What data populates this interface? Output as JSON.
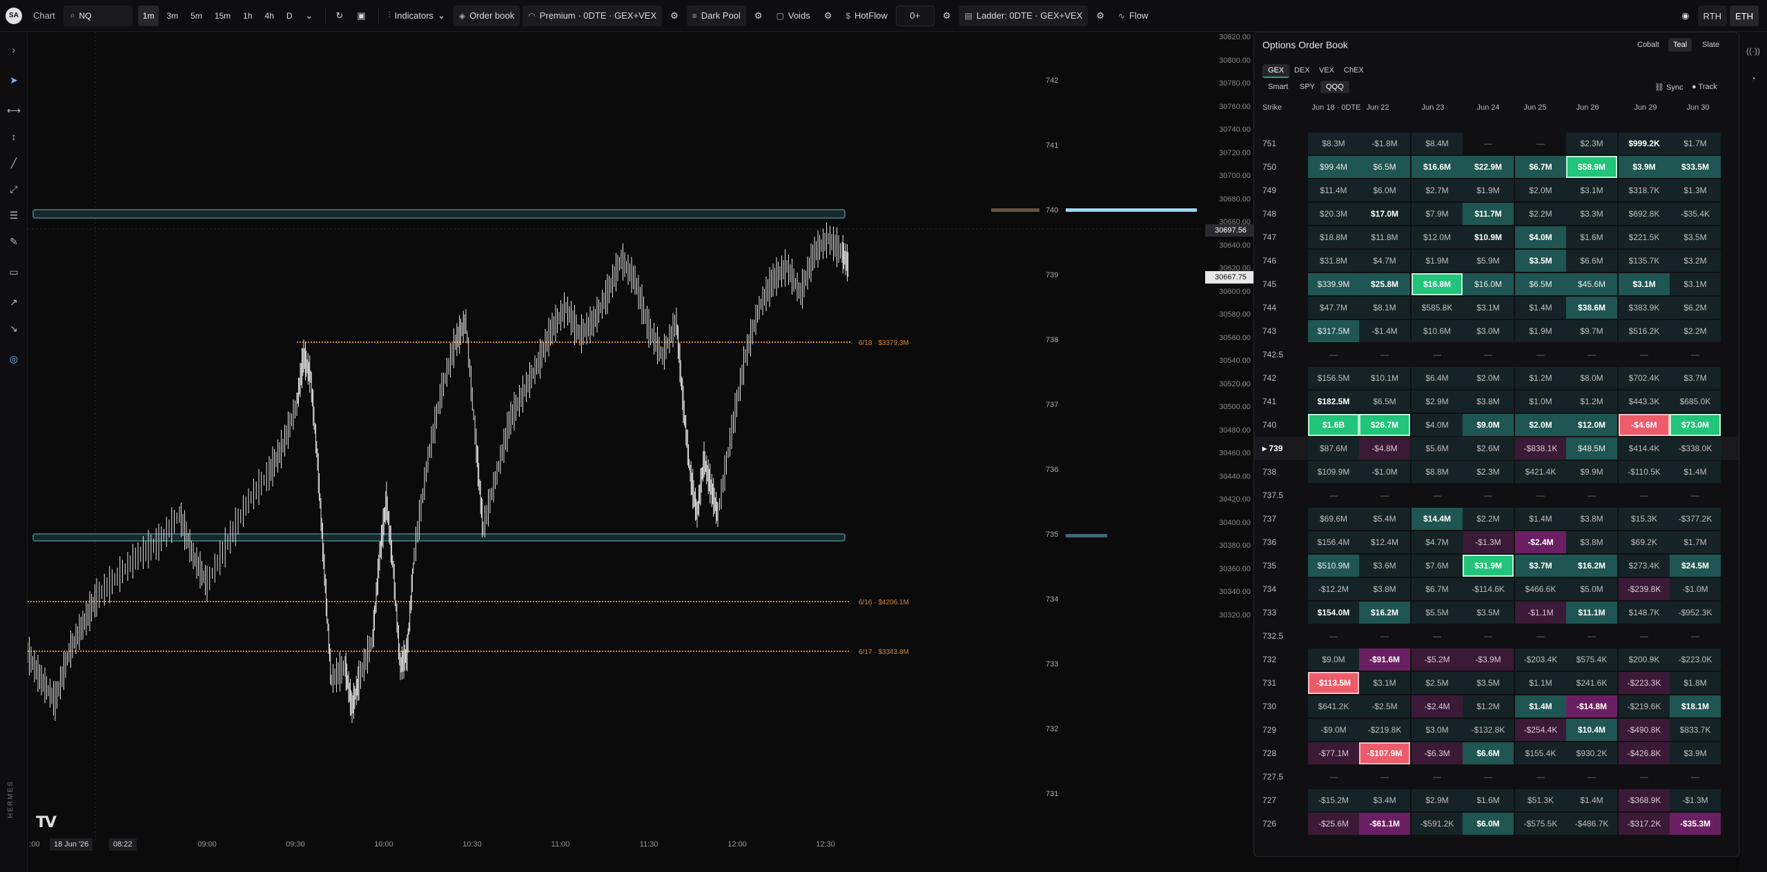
{
  "topbar": {
    "avatar": "SA",
    "app_title": "Chart",
    "symbol": "NQ",
    "timeframes": [
      "1m",
      "3m",
      "5m",
      "15m",
      "1h",
      "4h",
      "D"
    ],
    "selected_timeframe": "1m",
    "indicators": "Indicators",
    "order_book": "Order book",
    "premium": "Premium · 0DTE · GEX+VEX",
    "dark_pool": "Dark Pool",
    "voids": "Voids",
    "hotflow": "HotFlow",
    "hotflow_value": "0+",
    "ladder": "Ladder: 0DTE · GEX+VEX",
    "flow": "Flow",
    "rth": "RTH",
    "eth": "ETH"
  },
  "leftbar": {
    "brand": "HERMES"
  },
  "chart": {
    "price_axis_labels": [
      "30820.00",
      "30800.00",
      "30780.00",
      "30760.00",
      "30740.00",
      "30720.00",
      "30700.00",
      "30680.00",
      "30660.00",
      "30640.00",
      "30620.00",
      "30600.00",
      "30580.00",
      "30560.00",
      "30540.00",
      "30520.00",
      "30500.00",
      "30480.00",
      "30460.00",
      "30440.00",
      "30420.00",
      "30400.00",
      "30380.00",
      "30360.00",
      "30340.00",
      "30320.00"
    ],
    "price_badge_1": "30697.56",
    "price_badge_2": "30667.75",
    "strike_labels": [
      "742",
      "741",
      "740",
      "739",
      "738",
      "737",
      "736",
      "735",
      "734",
      "733",
      "732",
      "731"
    ],
    "time_labels": [
      "09:00",
      "09:30",
      "10:00",
      "10:30",
      "11:00",
      "11:30",
      "12:00",
      "12:30"
    ],
    "cursor_date": "18 Jun '26",
    "cursor_time": "08:22",
    "axis_start": ":00",
    "annotations": [
      "6/18 · $3379.3M",
      "6/16 · $4206.1M",
      "6/17 · $3343.8M"
    ],
    "logo": "TV",
    "colors": {
      "candle": "#e6e6e6",
      "gamma_level": "#3d6b70",
      "dark_pool": "#d4883a",
      "highlight": "#9bd8f0"
    }
  },
  "order_book": {
    "title": "Options Order Book",
    "themes": [
      "Cobalt",
      "Teal",
      "Slate"
    ],
    "selected_theme": "Teal",
    "greeks": [
      "GEX",
      "DEX",
      "VEX",
      "ChEX"
    ],
    "selected_greek": "GEX",
    "symbols": [
      "Smart",
      "SPY",
      "QQQ"
    ],
    "selected_symbol": "QQQ",
    "sync": "Sync",
    "track": "Track",
    "columns": [
      "Strike",
      "Jun 18 · 0DTE",
      "Jun 22",
      "Jun 23",
      "Jun 24",
      "Jun 25",
      "Jun 26",
      "Jun 29",
      "Jun 30"
    ],
    "current_strike": "739",
    "rows": [
      {
        "strike": "751",
        "cells": [
          [
            "$8.3M",
            "n"
          ],
          [
            "-$1.8M",
            "n"
          ],
          [
            "$8.4M",
            "n"
          ],
          [
            "—",
            "e"
          ],
          [
            "—",
            "e"
          ],
          [
            "$2.3M",
            "n"
          ],
          [
            "$999.2K",
            "wb"
          ],
          [
            "$1.7M",
            "n"
          ]
        ]
      },
      {
        "strike": "750",
        "cells": [
          [
            "$99.4M",
            "t"
          ],
          [
            "$6.5M",
            "t"
          ],
          [
            "$16.6M",
            "tb"
          ],
          [
            "$22.9M",
            "tb"
          ],
          [
            "$6.7M",
            "tb"
          ],
          [
            "$58.9M",
            "g"
          ],
          [
            "$3.9M",
            "tb"
          ],
          [
            "$33.5M",
            "tb"
          ]
        ]
      },
      {
        "strike": "749",
        "cells": [
          [
            "$11.4M",
            "n"
          ],
          [
            "$6.0M",
            "n"
          ],
          [
            "$2.7M",
            "n"
          ],
          [
            "$1.9M",
            "n"
          ],
          [
            "$2.0M",
            "n"
          ],
          [
            "$3.1M",
            "n"
          ],
          [
            "$318.7K",
            "n"
          ],
          [
            "$1.3M",
            "n"
          ]
        ]
      },
      {
        "strike": "748",
        "cells": [
          [
            "$20.3M",
            "n"
          ],
          [
            "$17.0M",
            "wb"
          ],
          [
            "$7.9M",
            "n"
          ],
          [
            "$11.7M",
            "tb"
          ],
          [
            "$2.2M",
            "n"
          ],
          [
            "$3.3M",
            "n"
          ],
          [
            "$692.8K",
            "n"
          ],
          [
            "-$35.4K",
            "n"
          ]
        ]
      },
      {
        "strike": "747",
        "cells": [
          [
            "$18.8M",
            "n"
          ],
          [
            "$11.8M",
            "n"
          ],
          [
            "$12.0M",
            "n"
          ],
          [
            "$10.9M",
            "wb"
          ],
          [
            "$4.0M",
            "tb"
          ],
          [
            "$1.6M",
            "n"
          ],
          [
            "$221.5K",
            "n"
          ],
          [
            "$3.5M",
            "n"
          ]
        ]
      },
      {
        "strike": "746",
        "cells": [
          [
            "$31.8M",
            "n"
          ],
          [
            "$4.7M",
            "n"
          ],
          [
            "$1.9M",
            "n"
          ],
          [
            "$5.9M",
            "n"
          ],
          [
            "$3.5M",
            "tb"
          ],
          [
            "$6.6M",
            "n"
          ],
          [
            "$135.7K",
            "n"
          ],
          [
            "$3.2M",
            "n"
          ]
        ]
      },
      {
        "strike": "745",
        "cells": [
          [
            "$339.9M",
            "t"
          ],
          [
            "$25.8M",
            "tb"
          ],
          [
            "$16.8M",
            "g"
          ],
          [
            "$16.0M",
            "t"
          ],
          [
            "$6.5M",
            "t"
          ],
          [
            "$45.6M",
            "t"
          ],
          [
            "$3.1M",
            "tb"
          ],
          [
            "$3.1M",
            "n"
          ]
        ]
      },
      {
        "strike": "744",
        "cells": [
          [
            "$47.7M",
            "n"
          ],
          [
            "$8.1M",
            "n"
          ],
          [
            "$585.8K",
            "n"
          ],
          [
            "$3.1M",
            "n"
          ],
          [
            "$1.4M",
            "n"
          ],
          [
            "$38.6M",
            "tb"
          ],
          [
            "$383.9K",
            "n"
          ],
          [
            "$6.2M",
            "n"
          ]
        ]
      },
      {
        "strike": "743",
        "cells": [
          [
            "$317.5M",
            "t"
          ],
          [
            "-$1.4M",
            "n"
          ],
          [
            "$10.6M",
            "n"
          ],
          [
            "$3.0M",
            "n"
          ],
          [
            "$1.9M",
            "n"
          ],
          [
            "$9.7M",
            "n"
          ],
          [
            "$516.2K",
            "n"
          ],
          [
            "$2.2M",
            "n"
          ]
        ]
      },
      {
        "strike": "742.5",
        "cells": [
          [
            "—",
            "e"
          ],
          [
            "—",
            "e"
          ],
          [
            "—",
            "e"
          ],
          [
            "—",
            "e"
          ],
          [
            "—",
            "e"
          ],
          [
            "—",
            "e"
          ],
          [
            "—",
            "e"
          ],
          [
            "—",
            "e"
          ]
        ]
      },
      {
        "strike": "742",
        "cells": [
          [
            "$156.5M",
            "n"
          ],
          [
            "$10.1M",
            "n"
          ],
          [
            "$6.4M",
            "n"
          ],
          [
            "$2.0M",
            "n"
          ],
          [
            "$1.2M",
            "n"
          ],
          [
            "$8.0M",
            "n"
          ],
          [
            "$702.4K",
            "n"
          ],
          [
            "$3.7M",
            "n"
          ]
        ]
      },
      {
        "strike": "741",
        "cells": [
          [
            "$182.5M",
            "wb"
          ],
          [
            "$6.5M",
            "n"
          ],
          [
            "$2.9M",
            "n"
          ],
          [
            "$3.8M",
            "n"
          ],
          [
            "$1.0M",
            "n"
          ],
          [
            "$1.2M",
            "n"
          ],
          [
            "$443.3K",
            "n"
          ],
          [
            "$685.0K",
            "n"
          ]
        ]
      },
      {
        "strike": "740",
        "cells": [
          [
            "$1.6B",
            "g"
          ],
          [
            "$26.7M",
            "g"
          ],
          [
            "$4.0M",
            "n"
          ],
          [
            "$9.0M",
            "tb"
          ],
          [
            "$2.0M",
            "tb"
          ],
          [
            "$12.0M",
            "tb"
          ],
          [
            "-$4.6M",
            "r"
          ],
          [
            "$73.0M",
            "g"
          ]
        ]
      },
      {
        "strike": "739",
        "cur": true,
        "cells": [
          [
            "$87.6M",
            "n"
          ],
          [
            "-$4.8M",
            "p"
          ],
          [
            "$5.6M",
            "n"
          ],
          [
            "$2.6M",
            "n"
          ],
          [
            "-$838.1K",
            "p"
          ],
          [
            "$48.5M",
            "t"
          ],
          [
            "$414.4K",
            "n"
          ],
          [
            "-$338.0K",
            "n"
          ]
        ]
      },
      {
        "strike": "738",
        "cells": [
          [
            "$109.9M",
            "n"
          ],
          [
            "-$1.0M",
            "n"
          ],
          [
            "$8.8M",
            "n"
          ],
          [
            "$2.3M",
            "n"
          ],
          [
            "$421.4K",
            "n"
          ],
          [
            "$9.9M",
            "n"
          ],
          [
            "-$110.5K",
            "n"
          ],
          [
            "$1.4M",
            "n"
          ]
        ]
      },
      {
        "strike": "737.5",
        "cells": [
          [
            "—",
            "e"
          ],
          [
            "—",
            "e"
          ],
          [
            "—",
            "e"
          ],
          [
            "—",
            "e"
          ],
          [
            "—",
            "e"
          ],
          [
            "—",
            "e"
          ],
          [
            "—",
            "e"
          ],
          [
            "—",
            "e"
          ]
        ]
      },
      {
        "strike": "737",
        "cells": [
          [
            "$69.6M",
            "n"
          ],
          [
            "$5.4M",
            "n"
          ],
          [
            "$14.4M",
            "tb"
          ],
          [
            "$2.2M",
            "n"
          ],
          [
            "$1.4M",
            "n"
          ],
          [
            "$3.8M",
            "n"
          ],
          [
            "$15.3K",
            "n"
          ],
          [
            "-$377.2K",
            "n"
          ]
        ]
      },
      {
        "strike": "736",
        "cells": [
          [
            "$156.4M",
            "n"
          ],
          [
            "$12.4M",
            "n"
          ],
          [
            "$4.7M",
            "n"
          ],
          [
            "-$1.3M",
            "p"
          ],
          [
            "-$2.4M",
            "pb"
          ],
          [
            "$3.8M",
            "n"
          ],
          [
            "$69.2K",
            "n"
          ],
          [
            "$1.7M",
            "n"
          ]
        ]
      },
      {
        "strike": "735",
        "cells": [
          [
            "$510.9M",
            "t"
          ],
          [
            "$3.6M",
            "n"
          ],
          [
            "$7.6M",
            "n"
          ],
          [
            "$31.9M",
            "g"
          ],
          [
            "$3.7M",
            "tb"
          ],
          [
            "$16.2M",
            "tb"
          ],
          [
            "$273.4K",
            "n"
          ],
          [
            "$24.5M",
            "tb"
          ]
        ]
      },
      {
        "strike": "734",
        "cells": [
          [
            "-$12.2M",
            "n"
          ],
          [
            "$3.8M",
            "n"
          ],
          [
            "$6.7M",
            "n"
          ],
          [
            "-$114.6K",
            "n"
          ],
          [
            "$466.6K",
            "n"
          ],
          [
            "$5.0M",
            "n"
          ],
          [
            "-$239.8K",
            "p"
          ],
          [
            "-$1.0M",
            "n"
          ]
        ]
      },
      {
        "strike": "733",
        "cells": [
          [
            "$154.0M",
            "wb"
          ],
          [
            "$16.2M",
            "tb"
          ],
          [
            "$5.5M",
            "n"
          ],
          [
            "$3.5M",
            "n"
          ],
          [
            "-$1.1M",
            "p"
          ],
          [
            "$11.1M",
            "tb"
          ],
          [
            "$148.7K",
            "n"
          ],
          [
            "-$952.3K",
            "n"
          ]
        ]
      },
      {
        "strike": "732.5",
        "cells": [
          [
            "—",
            "e"
          ],
          [
            "—",
            "e"
          ],
          [
            "—",
            "e"
          ],
          [
            "—",
            "e"
          ],
          [
            "—",
            "e"
          ],
          [
            "—",
            "e"
          ],
          [
            "—",
            "e"
          ],
          [
            "—",
            "e"
          ]
        ]
      },
      {
        "strike": "732",
        "cells": [
          [
            "$9.0M",
            "n"
          ],
          [
            "-$91.6M",
            "pb"
          ],
          [
            "-$5.2M",
            "p"
          ],
          [
            "-$3.9M",
            "p"
          ],
          [
            "-$203.4K",
            "n"
          ],
          [
            "$575.4K",
            "n"
          ],
          [
            "$200.9K",
            "n"
          ],
          [
            "-$223.0K",
            "n"
          ]
        ]
      },
      {
        "strike": "731",
        "cells": [
          [
            "-$113.5M",
            "r"
          ],
          [
            "$3.1M",
            "n"
          ],
          [
            "$2.5M",
            "n"
          ],
          [
            "$3.5M",
            "n"
          ],
          [
            "$1.1M",
            "n"
          ],
          [
            "$241.6K",
            "n"
          ],
          [
            "-$223.3K",
            "p"
          ],
          [
            "$1.8M",
            "n"
          ]
        ]
      },
      {
        "strike": "730",
        "cells": [
          [
            "$641.2K",
            "n"
          ],
          [
            "-$2.5M",
            "n"
          ],
          [
            "-$2.4M",
            "p"
          ],
          [
            "$1.2M",
            "n"
          ],
          [
            "$1.4M",
            "tb"
          ],
          [
            "-$14.8M",
            "pb"
          ],
          [
            "-$219.6K",
            "n"
          ],
          [
            "$18.1M",
            "tb"
          ]
        ]
      },
      {
        "strike": "729",
        "cells": [
          [
            "-$9.0M",
            "n"
          ],
          [
            "-$219.8K",
            "n"
          ],
          [
            "$3.0M",
            "n"
          ],
          [
            "-$132.8K",
            "n"
          ],
          [
            "-$254.4K",
            "p"
          ],
          [
            "$10.4M",
            "tb"
          ],
          [
            "-$490.8K",
            "p"
          ],
          [
            "$833.7K",
            "n"
          ]
        ]
      },
      {
        "strike": "728",
        "cells": [
          [
            "-$77.1M",
            "p"
          ],
          [
            "-$107.9M",
            "r"
          ],
          [
            "-$6.3M",
            "p"
          ],
          [
            "$6.6M",
            "tb"
          ],
          [
            "$155.4K",
            "n"
          ],
          [
            "$930.2K",
            "n"
          ],
          [
            "-$426.8K",
            "p"
          ],
          [
            "$3.9M",
            "n"
          ]
        ]
      },
      {
        "strike": "727.5",
        "cells": [
          [
            "—",
            "e"
          ],
          [
            "—",
            "e"
          ],
          [
            "—",
            "e"
          ],
          [
            "—",
            "e"
          ],
          [
            "—",
            "e"
          ],
          [
            "—",
            "e"
          ],
          [
            "—",
            "e"
          ],
          [
            "—",
            "e"
          ]
        ]
      },
      {
        "strike": "727",
        "cells": [
          [
            "-$15.2M",
            "n"
          ],
          [
            "$3.4M",
            "n"
          ],
          [
            "$2.9M",
            "n"
          ],
          [
            "$1.6M",
            "n"
          ],
          [
            "$51.3K",
            "n"
          ],
          [
            "$1.4M",
            "n"
          ],
          [
            "-$368.9K",
            "p"
          ],
          [
            "-$1.3M",
            "n"
          ]
        ]
      },
      {
        "strike": "726",
        "cells": [
          [
            "-$25.6M",
            "p"
          ],
          [
            "-$61.1M",
            "pb"
          ],
          [
            "-$591.2K",
            "n"
          ],
          [
            "$6.0M",
            "tb"
          ],
          [
            "-$575.5K",
            "n"
          ],
          [
            "-$486.7K",
            "n"
          ],
          [
            "-$317.2K",
            "p"
          ],
          [
            "-$35.3M",
            "pb"
          ]
        ]
      }
    ]
  }
}
